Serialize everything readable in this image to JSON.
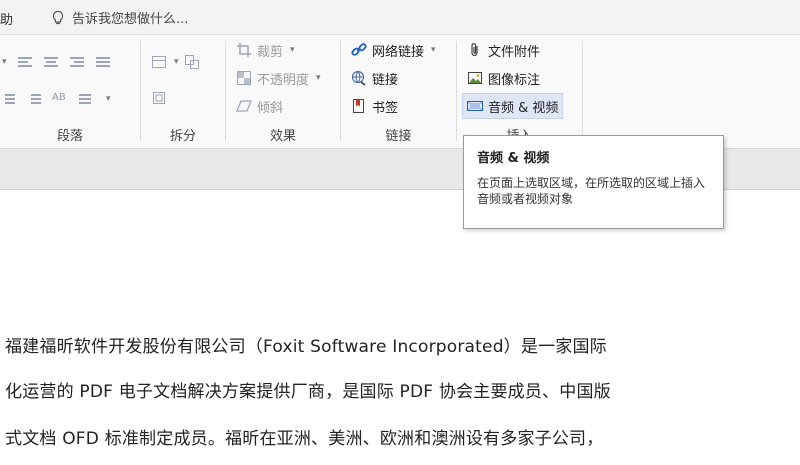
{
  "topbar": {
    "partial_tab": "助",
    "tell_me": "告诉我您想做什么..."
  },
  "groups": {
    "paragraph": "段落",
    "split": "拆分",
    "effects": "效果",
    "links": "链接",
    "insert": "插入"
  },
  "effects": {
    "crop": "裁剪",
    "opacity": "不透明度",
    "skew": "倾斜"
  },
  "links": {
    "web_link": "网络链接",
    "link": "链接",
    "bookmark": "书签"
  },
  "insert": {
    "file_attachment": "文件附件",
    "image_annotation": "图像标注",
    "audio_video": "音频 & 视频"
  },
  "tooltip": {
    "title": "音频 & 视频",
    "body": "在页面上选取区域，在所选取的区域上插入音频或者视频对象"
  },
  "document": {
    "lines": [
      "福建福昕软件开发股份有限公司（Foxit Software Incorporated）是一家国际",
      "化运营的 PDF 电子文档解决方案提供厂商，是国际 PDF 协会主要成员、中国版",
      "式文档 OFD 标准制定成员。福昕在亚洲、美洲、欧洲和澳洲设有多家子公司，"
    ]
  },
  "colors": {
    "accent": "#1f5fbf",
    "hover": "#dfe6f6"
  }
}
